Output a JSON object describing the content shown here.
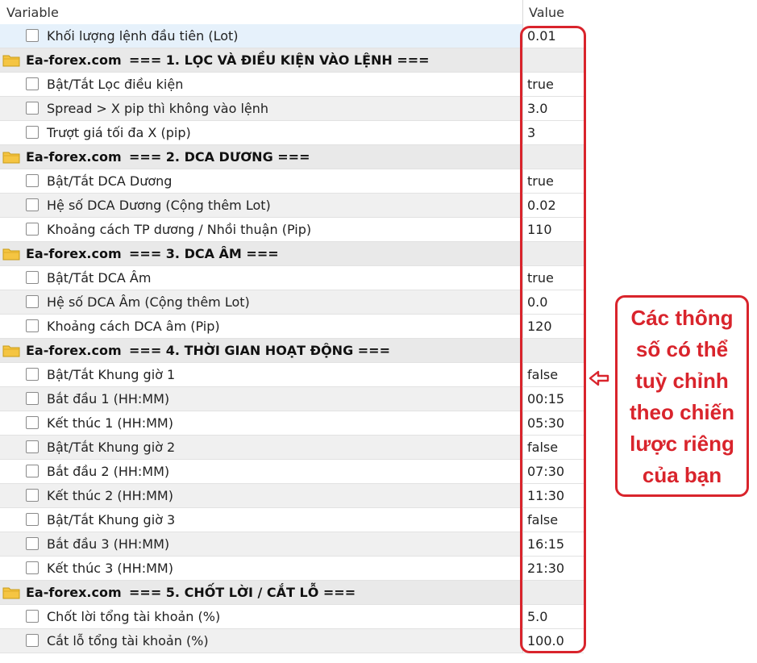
{
  "header": {
    "variable_label": "Variable",
    "value_label": "Value"
  },
  "rows": [
    {
      "type": "param",
      "label": "Khối lượng lệnh đầu tiên (Lot)",
      "value": "0.01",
      "selected": true
    },
    {
      "type": "group",
      "source": "Ea-forex.com",
      "title": "=== 1. LỌC VÀ ĐIỀU KIỆN VÀO LỆNH ==="
    },
    {
      "type": "param",
      "label": "Bật/Tắt Lọc điều kiện",
      "value": "true"
    },
    {
      "type": "param",
      "label": "Spread > X pip thì không vào lệnh",
      "value": "3.0"
    },
    {
      "type": "param",
      "label": "Trượt giá tối đa X (pip)",
      "value": "3"
    },
    {
      "type": "group",
      "source": "Ea-forex.com",
      "title": "=== 2. DCA DƯƠNG ==="
    },
    {
      "type": "param",
      "label": "Bật/Tắt DCA Dương",
      "value": "true"
    },
    {
      "type": "param",
      "label": "Hệ số DCA Dương (Cộng thêm Lot)",
      "value": "0.02"
    },
    {
      "type": "param",
      "label": "Khoảng cách TP dương / Nhồi thuận (Pip)",
      "value": "110"
    },
    {
      "type": "group",
      "source": "Ea-forex.com",
      "title": "=== 3. DCA ÂM ==="
    },
    {
      "type": "param",
      "label": "Bật/Tắt DCA Âm",
      "value": "true"
    },
    {
      "type": "param",
      "label": "Hệ số DCA Âm (Cộng thêm Lot)",
      "value": "0.0"
    },
    {
      "type": "param",
      "label": "Khoảng cách DCA âm (Pip)",
      "value": "120"
    },
    {
      "type": "group",
      "source": "Ea-forex.com",
      "title": "=== 4. THỜI GIAN HOẠT ĐỘNG ==="
    },
    {
      "type": "param",
      "label": "Bật/Tắt Khung giờ 1",
      "value": "false"
    },
    {
      "type": "param",
      "label": "Bắt đầu 1 (HH:MM)",
      "value": "00:15"
    },
    {
      "type": "param",
      "label": "Kết thúc 1 (HH:MM)",
      "value": "05:30"
    },
    {
      "type": "param",
      "label": "Bật/Tắt Khung giờ 2",
      "value": "false"
    },
    {
      "type": "param",
      "label": "Bắt đầu 2 (HH:MM)",
      "value": "07:30"
    },
    {
      "type": "param",
      "label": "Kết thúc 2 (HH:MM)",
      "value": "11:30"
    },
    {
      "type": "param",
      "label": "Bật/Tắt Khung giờ 3",
      "value": "false"
    },
    {
      "type": "param",
      "label": "Bắt đầu 3 (HH:MM)",
      "value": "16:15"
    },
    {
      "type": "param",
      "label": "Kết thúc 3 (HH:MM)",
      "value": "21:30"
    },
    {
      "type": "group",
      "source": "Ea-forex.com",
      "title": "=== 5. CHỐT LỜI / CẮT LỖ ==="
    },
    {
      "type": "param",
      "label": "Chốt lời tổng tài khoản (%)",
      "value": "5.0"
    },
    {
      "type": "param",
      "label": "Cắt lỗ tổng tài khoản (%)",
      "value": "100.0"
    }
  ],
  "annotation": {
    "lines": [
      "Các thông",
      "số có thể",
      "tuỳ chỉnh",
      "theo chiến",
      "lược riêng",
      "của bạn"
    ],
    "color": "#d9242c",
    "arrow_icon": "arrow-left-icon"
  },
  "colors": {
    "accent_red": "#d9242c",
    "folder": "#f5c542",
    "group_row": "#e9e9e9",
    "selected_row": "#e6f1fb"
  }
}
